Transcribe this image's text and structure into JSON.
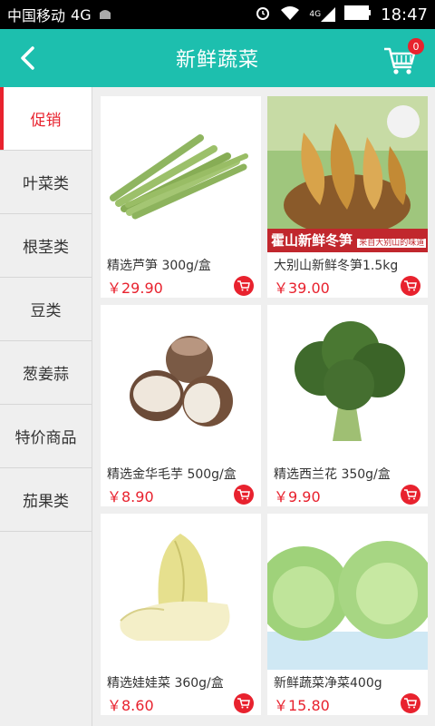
{
  "status": {
    "carrier": "中国移动",
    "network": "4G",
    "signal_label": "4G",
    "time": "18:47"
  },
  "header": {
    "title": "新鲜蔬菜",
    "cart_count": "0"
  },
  "sidebar": {
    "items": [
      {
        "label": "促销",
        "active": true
      },
      {
        "label": "叶菜类"
      },
      {
        "label": "根茎类"
      },
      {
        "label": "豆类"
      },
      {
        "label": "葱姜蒜"
      },
      {
        "label": "特价商品"
      },
      {
        "label": "茄果类"
      }
    ]
  },
  "products": [
    {
      "name": "精选芦笋 300g/盒",
      "price": "￥29.90",
      "image": "asparagus"
    },
    {
      "name": "大别山新鲜冬笋1.5kg",
      "price": "￥39.00",
      "image": "bamboo-shoots",
      "banner": "霍山新鲜冬笋",
      "banner_sub": "来自大别山的味道"
    },
    {
      "name": "精选金华毛芋 500g/盒",
      "price": "￥8.90",
      "image": "taro"
    },
    {
      "name": "精选西兰花 350g/盒",
      "price": "￥9.90",
      "image": "broccoli"
    },
    {
      "name": "精选娃娃菜 360g/盒",
      "price": "￥8.60",
      "image": "baby-cabbage"
    },
    {
      "name": "新鲜蔬菜净菜400g",
      "price": "￥15.80",
      "image": "lettuce"
    }
  ]
}
